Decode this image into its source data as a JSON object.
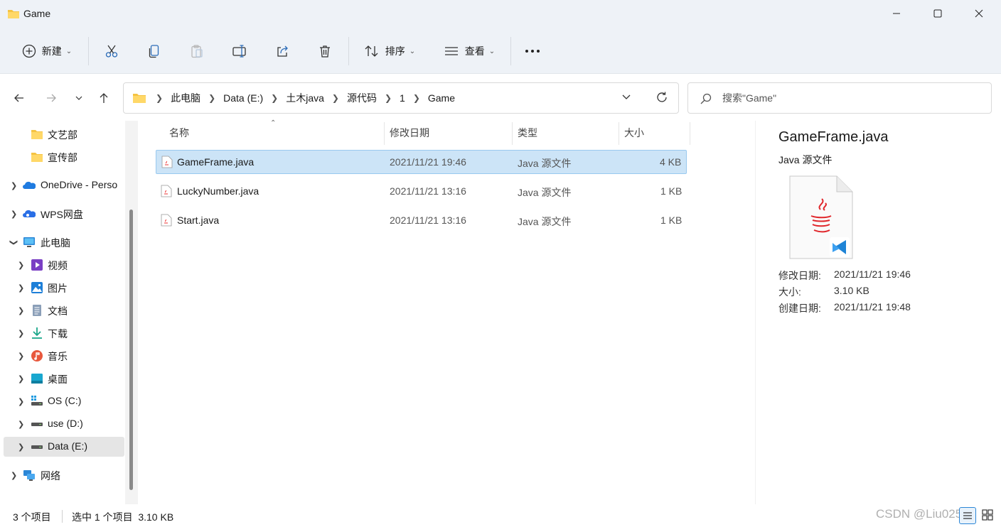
{
  "window": {
    "title": "Game",
    "controls": [
      "minimize",
      "maximize",
      "close"
    ]
  },
  "toolbar": {
    "new_label": "新建",
    "sort_label": "排序",
    "view_label": "查看",
    "icons": [
      "plus-circle-icon",
      "cut-icon",
      "copy-icon",
      "paste-icon",
      "rename-icon",
      "share-icon",
      "delete-icon",
      "sort-icon",
      "view-icon",
      "more-icon"
    ]
  },
  "nav": {
    "breadcrumb": [
      "此电脑",
      "Data (E:)",
      "土木java",
      "源代码",
      "1",
      "Game"
    ],
    "search_placeholder": "搜索\"Game\""
  },
  "sidebar": {
    "items": [
      {
        "label": "文艺部",
        "icon": "folder-icon"
      },
      {
        "label": "宣传部",
        "icon": "folder-icon"
      },
      {
        "label": "OneDrive - Perso",
        "icon": "onedrive-icon"
      },
      {
        "label": "WPS网盘",
        "icon": "wps-cloud-icon"
      },
      {
        "label": "此电脑",
        "icon": "computer-icon"
      },
      {
        "label": "视频",
        "icon": "video-icon"
      },
      {
        "label": "图片",
        "icon": "picture-icon"
      },
      {
        "label": "文档",
        "icon": "document-icon"
      },
      {
        "label": "下载",
        "icon": "download-icon"
      },
      {
        "label": "音乐",
        "icon": "music-icon"
      },
      {
        "label": "桌面",
        "icon": "desktop-icon"
      },
      {
        "label": "OS (C:)",
        "icon": "drive-icon"
      },
      {
        "label": "use (D:)",
        "icon": "drive-icon"
      },
      {
        "label": "Data (E:)",
        "icon": "drive-icon"
      },
      {
        "label": "网络",
        "icon": "network-icon"
      }
    ]
  },
  "files": {
    "columns": [
      "名称",
      "修改日期",
      "类型",
      "大小"
    ],
    "rows": [
      {
        "name": "GameFrame.java",
        "date": "2021/11/21 19:46",
        "type": "Java 源文件",
        "size": "4 KB"
      },
      {
        "name": "LuckyNumber.java",
        "date": "2021/11/21 13:16",
        "type": "Java 源文件",
        "size": "1 KB"
      },
      {
        "name": "Start.java",
        "date": "2021/11/21 13:16",
        "type": "Java 源文件",
        "size": "1 KB"
      }
    ]
  },
  "details": {
    "name": "GameFrame.java",
    "type": "Java 源文件",
    "props": [
      {
        "key": "修改日期:",
        "value": "2021/11/21 19:46"
      },
      {
        "key": "大小:",
        "value": "3.10 KB"
      },
      {
        "key": "创建日期:",
        "value": "2021/11/21 19:48"
      }
    ]
  },
  "status": {
    "count": "3 个项目",
    "selection": "选中 1 个项目  3.10 KB"
  },
  "watermark": "CSDN @Liu0252"
}
